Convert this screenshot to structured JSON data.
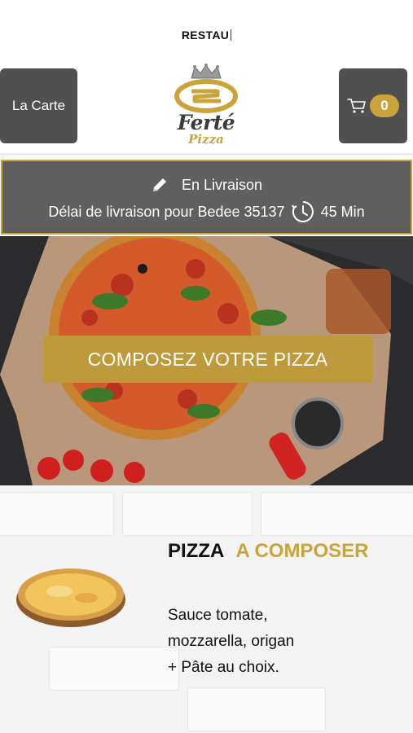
{
  "status_bar": {
    "title": "RESTAU"
  },
  "header": {
    "menu_label": "La Carte",
    "cart_count": "0",
    "logo": {
      "brand": "Ferté",
      "sub": "Pizza",
      "emblem": "crown-icon"
    }
  },
  "delivery": {
    "mode": "En Livraison",
    "text": "Délai de livraison pour Bedee 35137",
    "time": "45 Min",
    "icons": [
      "pencil-icon",
      "clock-icon"
    ]
  },
  "hero": {
    "cta_label": "COMPOSEZ VOTRE PIZZA"
  },
  "product": {
    "title_main": "PIZZA",
    "title_accent": "A COMPOSER",
    "description": [
      "Sauce tomate,",
      "mozzarella, origan",
      "+ Pâte au choix."
    ]
  },
  "colors": {
    "gold": "#c9a43a",
    "button_dark": "#505050",
    "delivery_bg": "#5f5f5f",
    "banner_gold": "#bf9a3b"
  }
}
